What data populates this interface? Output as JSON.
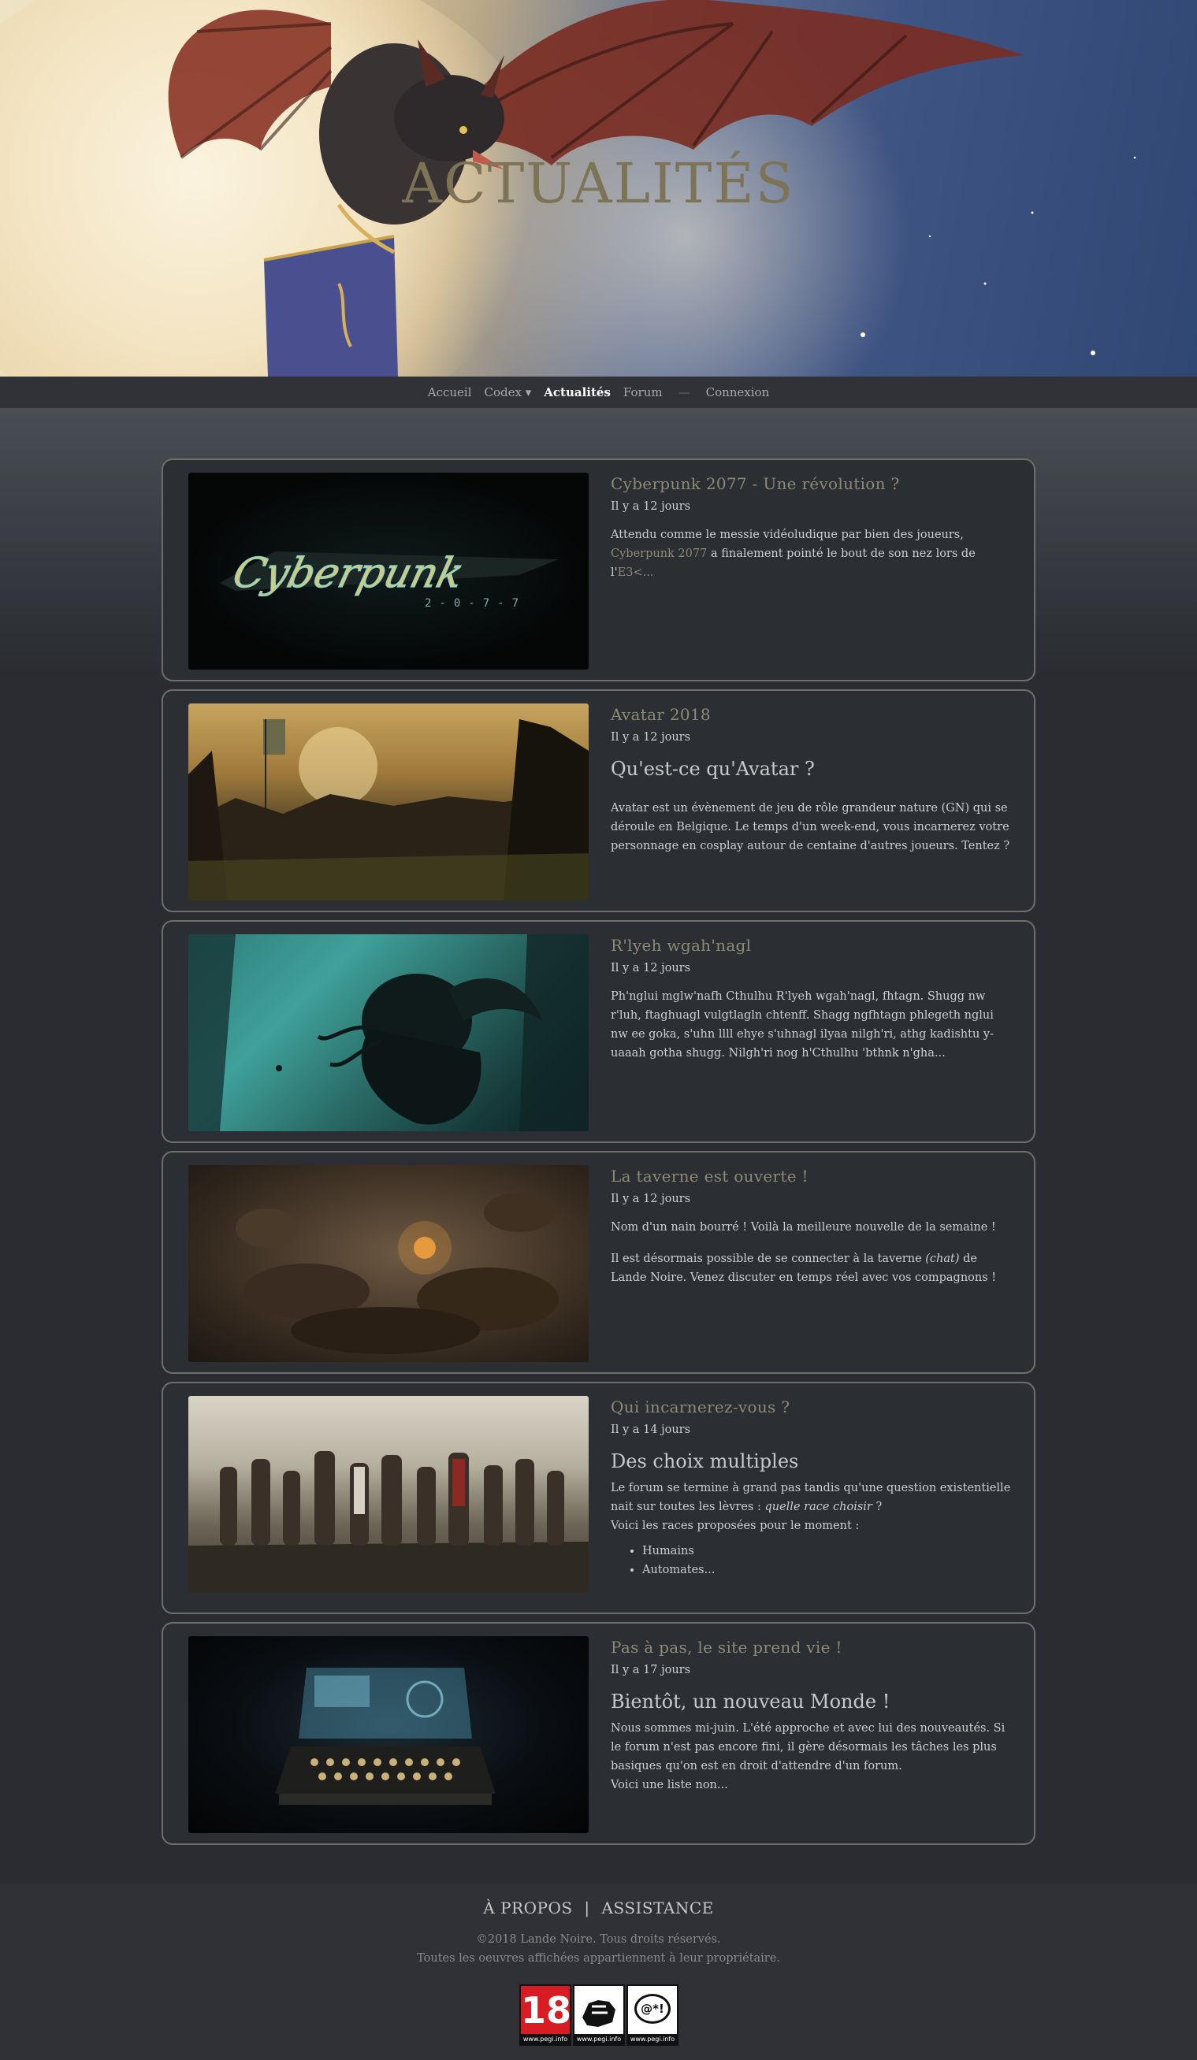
{
  "hero": {
    "title": "ACTUALITÉS"
  },
  "nav": {
    "items": [
      {
        "label": "Accueil"
      },
      {
        "label": "Codex ▾"
      },
      {
        "label": "Actualités"
      },
      {
        "label": "Forum"
      },
      {
        "label": "Connexion"
      }
    ],
    "separator": "—"
  },
  "articles": [
    {
      "title": "Cyberpunk 2077 - Une révolution ?",
      "date": "Il y a 12 jours",
      "p1_start": "Attendu comme le messie vidéoludique par bien des joueurs, ",
      "link1": "Cyberpunk 2077",
      "p1_mid": " a finalement pointé le bout de son nez lors de l'",
      "link2": "E3<...",
      "image": "cyberpunk-logo"
    },
    {
      "title": "Avatar 2018",
      "date": "Il y a 12 jours",
      "heading": "Qu'est-ce qu'Avatar ?",
      "p1": "Avatar est un évènement de jeu de rôle grandeur nature (GN) qui se déroule en Belgique. Le temps d'un week-end, vous incarnerez votre personnage en cosplay autour de centaine d'autres joueurs. Tentez ?",
      "image": "larp-crowd"
    },
    {
      "title": "R'lyeh wgah'nagl",
      "date": "Il y a 12 jours",
      "p1": "Ph'nglui mglw'nafh Cthulhu R'lyeh wgah'nagl, fhtagn. Shugg nw r'luh, ftaghuagl vulgtlagln chtenff. Shagg ngfhtagn phlegeth nglui nw ee goka, s'uhn llll ehye s'uhnagl ilyaa nilgh'ri, athg kadishtu y-uaaah gotha shugg. Nilgh'ri nog h'Cthulhu 'bthnk n'gha...",
      "image": "cthulhu"
    },
    {
      "title": "La taverne est ouverte !",
      "date": "Il y a 12 jours",
      "p1": "Nom d'un nain bourré ! Voilà la meilleure nouvelle de la semaine !",
      "p2_start": "Il est désormais possible de se connecter à la taverne ",
      "p2_em": "(chat)",
      "p2_end": " de Lande Noire. Venez discuter en temps réel avec vos compagnons !",
      "image": "tavern"
    },
    {
      "title": "Qui incarnerez-vous ?",
      "date": "Il y a 14 jours",
      "heading": "Des choix multiples",
      "p1_start": "Le forum se termine à grand pas tandis qu'une question existentielle nait sur toutes les lèvres : ",
      "p1_em": "quelle race choisir",
      "p1_end": " ?",
      "p2": "Voici les races proposées pour le moment :",
      "list": [
        "Humains",
        "Automates..."
      ],
      "image": "races-group"
    },
    {
      "title": "Pas à pas, le site prend vie !",
      "date": "Il y a 17 jours",
      "heading": "Bientôt, un nouveau Monde !",
      "p1": "Nous sommes mi-juin. L'été approche et avec lui des nouveautés. Si le forum n'est pas encore fini, il gère désormais les tâches les plus basiques qu'on est en droit d'attendre d'un forum.",
      "p2": "Voici une liste non...",
      "image": "typewriter-hologram"
    }
  ],
  "footer": {
    "about": "À PROPOS",
    "divider": "|",
    "help": "ASSISTANCE",
    "copyright": "©2018 Lande Noire. Tous droits réservés.",
    "rights": "Toutes les oeuvres affichées appartiennent à leur propriétaire.",
    "pegi": [
      {
        "label": "18",
        "url": "www.pegi.info"
      },
      {
        "label": "violence",
        "url": "www.pegi.info"
      },
      {
        "label": "@*!",
        "url": "www.pegi.info"
      }
    ]
  },
  "colors": {
    "accent": "#8f8a75",
    "background": "#2a2c31",
    "card_border": "#6f6f6a"
  }
}
